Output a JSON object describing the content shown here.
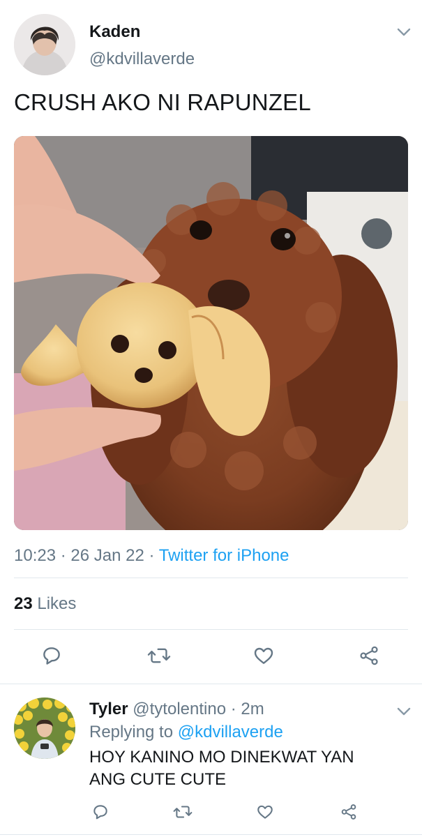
{
  "tweet": {
    "author_name": "Kaden",
    "author_handle": "@kdvillaverde",
    "text": "CRUSH AKO NI RAPUNZEL",
    "time": "10:23",
    "date": "26 Jan 22",
    "separator": "·",
    "source": "Twitter for iPhone",
    "likes_count": "23",
    "likes_label": "Likes"
  },
  "reply": {
    "author_name": "Tyler",
    "author_handle": "@tytolentino",
    "separator": "·",
    "time": "2m",
    "replying_prefix": "Replying to",
    "replying_to": "@kdvillaverde",
    "text": "HOY KANINO MO DINEKWAT YAN ANG CUTE CUTE"
  },
  "icons": {
    "reply": "reply-icon",
    "retweet": "retweet-icon",
    "like": "heart-icon",
    "share": "share-icon",
    "menu": "chevron-down-icon"
  },
  "colors": {
    "link": "#1da1f2",
    "secondary_text": "#657786",
    "primary_text": "#14171a",
    "divider": "#e1e8ed"
  }
}
